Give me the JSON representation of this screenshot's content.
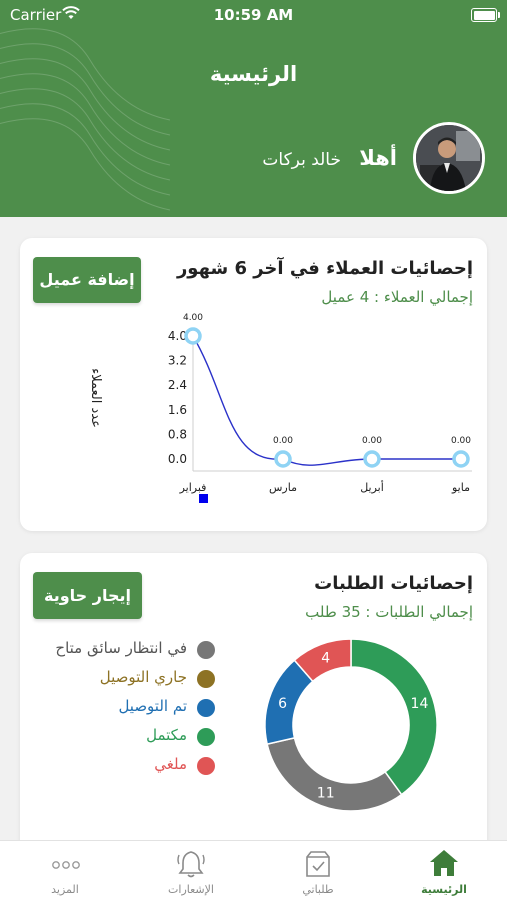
{
  "status_bar": {
    "carrier": "Carrier",
    "time": "10:59 AM"
  },
  "header": {
    "title": "الرئيسية",
    "greeting": "أهلا",
    "user_name": "خالد بركات"
  },
  "customers_card": {
    "title": "إحصائيات العملاء في آخر 6 شهور",
    "total": "إجمالي العملاء : 4 عميل",
    "button": "إضافة عميل"
  },
  "orders_card": {
    "title": "إحصائيات الطلبات",
    "total": "إجمالي الطلبات : 35 طلب",
    "button": "إيجار حاوية",
    "legend": [
      {
        "label": "في انتظار سائق متاح",
        "color": "#777777"
      },
      {
        "label": "جاري التوصيل",
        "color": "#8d7224"
      },
      {
        "label": "تم التوصيل",
        "color": "#1f6fb2"
      },
      {
        "label": "مكتمل",
        "color": "#2e9c58"
      },
      {
        "label": "ملغي",
        "color": "#e05555"
      }
    ]
  },
  "chart_data": [
    {
      "type": "line",
      "ylabel": "عدد العملاء",
      "categories": [
        "فبراير",
        "مارس",
        "أبريل",
        "مايو"
      ],
      "values": [
        4,
        0,
        0,
        0
      ],
      "data_labels": [
        "4.00",
        "0.00",
        "0.00",
        "0.00"
      ],
      "y_ticks": [
        "0.0",
        "0.8",
        "1.6",
        "2.4",
        "3.2",
        "4.0"
      ],
      "ylim": [
        0,
        4
      ],
      "line_color": "#2b32c9",
      "marker_color": "#8fd3f4",
      "legend_color": "#0000ee"
    },
    {
      "type": "pie",
      "donut": true,
      "slices": [
        {
          "value": 14,
          "label": "14",
          "color": "#2e9c58"
        },
        {
          "value": 11,
          "label": "11",
          "color": "#777777"
        },
        {
          "value": 6,
          "label": "6",
          "color": "#1f6fb2"
        },
        {
          "value": 4,
          "label": "4",
          "color": "#e05555"
        }
      ]
    }
  ],
  "tabbar": {
    "items": [
      {
        "label": "الرئيسية",
        "icon": "home-icon",
        "active": true
      },
      {
        "label": "طلباتي",
        "icon": "box-icon",
        "active": false
      },
      {
        "label": "الإشعارات",
        "icon": "bell-icon",
        "active": false
      },
      {
        "label": "المزيد",
        "icon": "more-icon",
        "active": false
      }
    ]
  }
}
